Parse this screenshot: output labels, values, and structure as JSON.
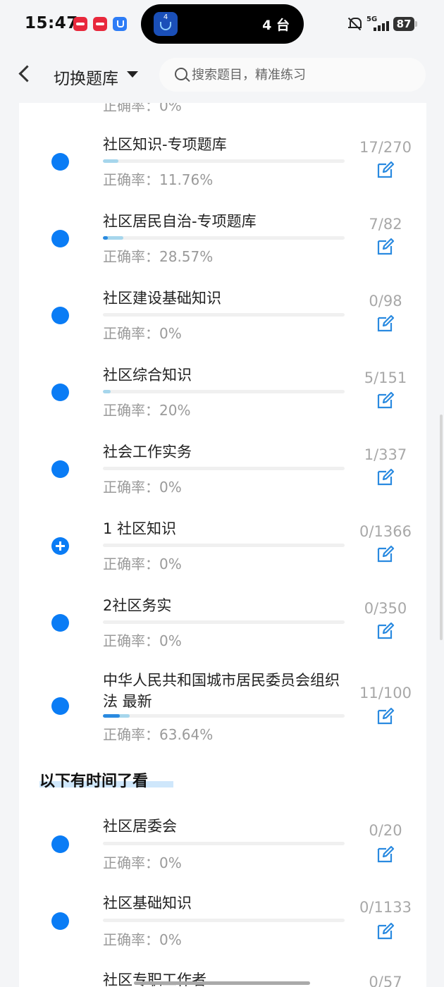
{
  "status_bar": {
    "time": "15:47",
    "island_badge": "4",
    "island_text": "4 台",
    "network": "5G",
    "battery": "87"
  },
  "header": {
    "title": "切换题库",
    "search_placeholder": "搜索题目，精准练习"
  },
  "partial_top_accuracy": "正确率：0%",
  "section_title": "以下有时间了看",
  "items": [
    {
      "title": "社区知识-专项题库",
      "accuracy": "正确率：11.76%",
      "count": "17/270",
      "progress": 0.063
    },
    {
      "title": "社区居民自治-专项题库",
      "accuracy": "正确率：28.57%",
      "count": "7/82",
      "progress": 0.085
    },
    {
      "title": "社区建设基础知识",
      "accuracy": "正确率：0%",
      "count": "0/98",
      "progress": 0
    },
    {
      "title": "社区综合知识",
      "accuracy": "正确率：20%",
      "count": "5/151",
      "progress": 0.033
    },
    {
      "title": "社会工作实务",
      "accuracy": "正确率：0%",
      "count": "1/337",
      "progress": 0.003
    },
    {
      "title": "1 社区知识",
      "accuracy": "正确率：0%",
      "count": "0/1366",
      "progress": 0
    },
    {
      "title": "2社区务实",
      "accuracy": "正确率：0%",
      "count": "0/350",
      "progress": 0
    },
    {
      "title": "中华人民共和国城市居民委员会组织法 最新",
      "accuracy": "正确率：63.64%",
      "count": "11/100",
      "progress": 0.11
    },
    {
      "title": "社区居委会",
      "accuracy": "正确率：0%",
      "count": "0/20",
      "progress": 0
    },
    {
      "title": "社区基础知识",
      "accuracy": "正确率：0%",
      "count": "0/1133",
      "progress": 0
    },
    {
      "title": "社区专职工作者",
      "accuracy": "",
      "count": "0/57",
      "progress": 0
    }
  ]
}
